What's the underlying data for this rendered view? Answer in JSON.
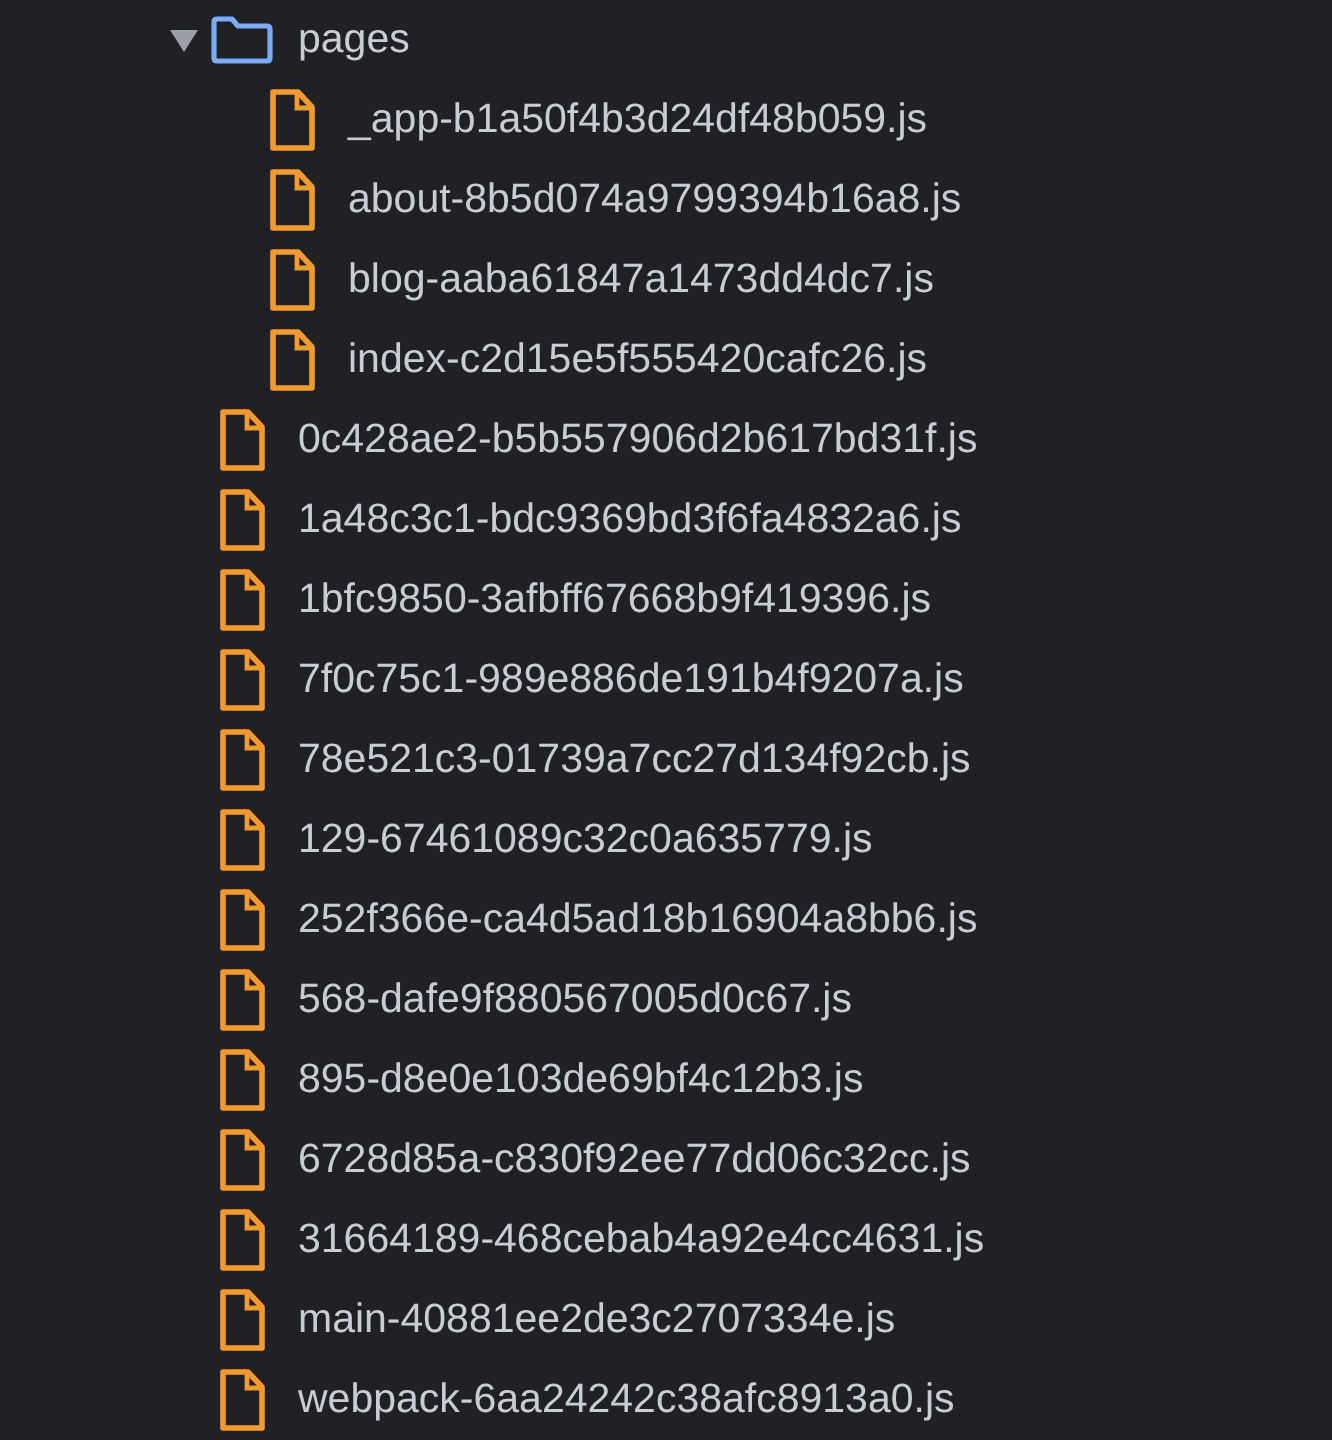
{
  "tree": [
    {
      "kind": "folder",
      "name": "pages",
      "expanded": true,
      "children": [
        {
          "kind": "file",
          "name": "_app-b1a50f4b3d24df48b059.js"
        },
        {
          "kind": "file",
          "name": "about-8b5d074a9799394b16a8.js"
        },
        {
          "kind": "file",
          "name": "blog-aaba61847a1473dd4dc7.js"
        },
        {
          "kind": "file",
          "name": "index-c2d15e5f555420cafc26.js"
        }
      ]
    },
    {
      "kind": "file",
      "name": "0c428ae2-b5b557906d2b617bd31f.js"
    },
    {
      "kind": "file",
      "name": "1a48c3c1-bdc9369bd3f6fa4832a6.js"
    },
    {
      "kind": "file",
      "name": "1bfc9850-3afbff67668b9f419396.js"
    },
    {
      "kind": "file",
      "name": "7f0c75c1-989e886de191b4f9207a.js"
    },
    {
      "kind": "file",
      "name": "78e521c3-01739a7cc27d134f92cb.js"
    },
    {
      "kind": "file",
      "name": "129-67461089c32c0a635779.js"
    },
    {
      "kind": "file",
      "name": "252f366e-ca4d5ad18b16904a8bb6.js"
    },
    {
      "kind": "file",
      "name": "568-dafe9f880567005d0c67.js"
    },
    {
      "kind": "file",
      "name": "895-d8e0e103de69bf4c12b3.js"
    },
    {
      "kind": "file",
      "name": "6728d85a-c830f92ee77dd06c32cc.js"
    },
    {
      "kind": "file",
      "name": "31664189-468cebab4a92e4cc4631.js"
    },
    {
      "kind": "file",
      "name": "main-40881ee2de3c2707334e.js"
    },
    {
      "kind": "file",
      "name": "webpack-6aa24242c38afc8913a0.js"
    }
  ]
}
